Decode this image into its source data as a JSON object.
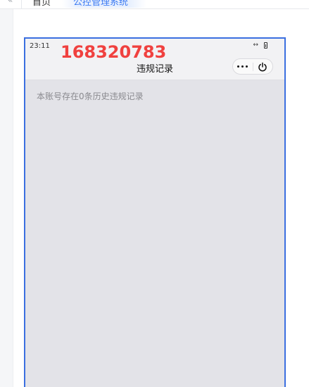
{
  "tabs": {
    "nav_arrow": "«",
    "home_label": "首页",
    "active_label": "公控管理系统"
  },
  "phone": {
    "time": "23:11",
    "status_sync_icon": "↔",
    "watermark": "168320783",
    "page_title": "违规记录",
    "menu_icon": "more-dots-icon",
    "close_icon": "power-icon",
    "notice": "本账号存在0条历史违规记录"
  },
  "colors": {
    "frame_border": "#3b6fe0",
    "watermark": "#f0413f",
    "body_bg": "#e3e3e8"
  }
}
